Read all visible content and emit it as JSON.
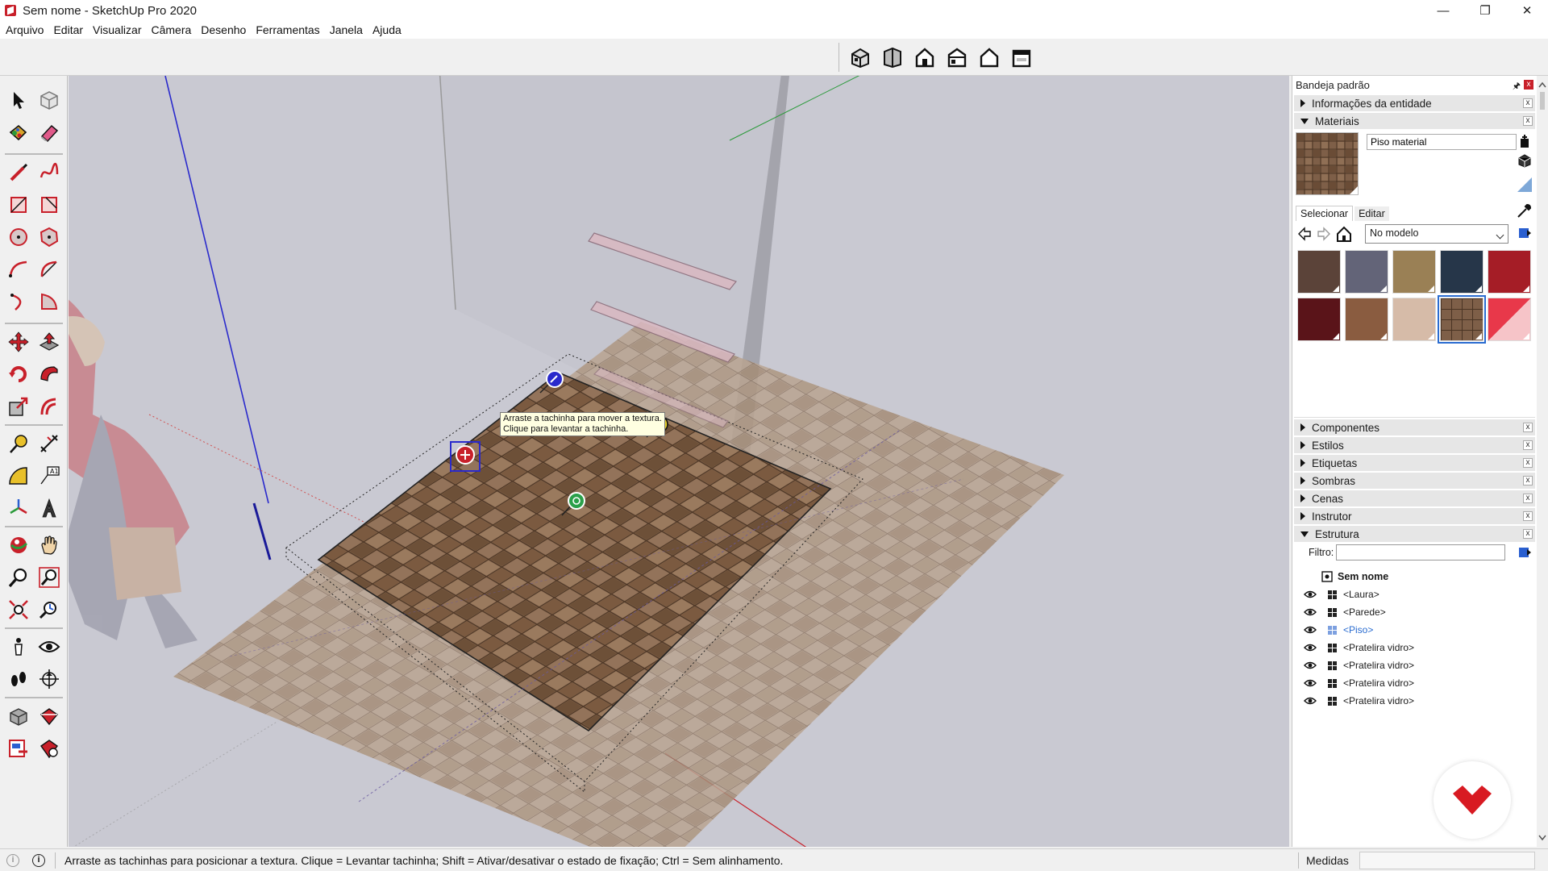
{
  "window": {
    "title": "Sem nome - SketchUp Pro 2020",
    "minimize_glyph": "—",
    "restore_glyph": "❐",
    "close_glyph": "✕"
  },
  "menu": [
    "Arquivo",
    "Editar",
    "Visualizar",
    "Câmera",
    "Desenho",
    "Ferramentas",
    "Janela",
    "Ajuda"
  ],
  "view_toolbar": [
    "iso-view-icon",
    "top-view-icon",
    "front-view-icon",
    "right-view-icon",
    "back-view-icon",
    "left-view-icon"
  ],
  "tooltip": {
    "line1": "Arraste a tachinha para mover a textura.",
    "line2": "Clique para levantar a tachinha."
  },
  "tray": {
    "title": "Bandeja padrão",
    "pin_glyph": "🖈",
    "close_glyph": "x",
    "panels_top": [
      {
        "label": "Informações da entidade",
        "expanded": false
      },
      {
        "label": "Materiais",
        "expanded": true
      }
    ],
    "materials": {
      "name": "Piso material",
      "tab_select": "Selecionar",
      "tab_edit": "Editar",
      "library": "No modelo",
      "swatches": [
        "#5b4339",
        "#636478",
        "#9a8055",
        "#263649",
        "#a51d26",
        "#5a1419",
        "#8a5c40",
        "#d6bba8",
        "texture",
        "#e8384a"
      ],
      "selected_index": 8
    },
    "panels_bottom": [
      {
        "label": "Componentes",
        "expanded": false
      },
      {
        "label": "Estilos",
        "expanded": false
      },
      {
        "label": "Etiquetas",
        "expanded": false
      },
      {
        "label": "Sombras",
        "expanded": false
      },
      {
        "label": "Cenas",
        "expanded": false
      },
      {
        "label": "Instrutor",
        "expanded": false
      },
      {
        "label": "Estrutura",
        "expanded": true
      }
    ],
    "outliner": {
      "filter_label": "Filtro:",
      "root": "Sem nome",
      "items": [
        {
          "label": "<Laura>",
          "selected": false
        },
        {
          "label": "<Parede>",
          "selected": false
        },
        {
          "label": "<Piso>",
          "selected": true
        },
        {
          "label": "<Pratelira vidro>",
          "selected": false
        },
        {
          "label": "<Pratelira vidro>",
          "selected": false
        },
        {
          "label": "<Pratelira vidro>",
          "selected": false
        },
        {
          "label": "<Pratelira vidro>",
          "selected": false
        }
      ]
    }
  },
  "status": {
    "info_glyph": "i",
    "text": "Arraste as tachinhas para posicionar a textura. Clique = Levantar tachinha; Shift = Ativar/desativar o estado de fixação; Ctrl = Sem alinhamento.",
    "measure_label": "Medidas"
  },
  "colors": {
    "accent_red": "#c8202a",
    "selection_blue": "#2a6cd0",
    "viewport_bg": "#c8c8d0"
  }
}
